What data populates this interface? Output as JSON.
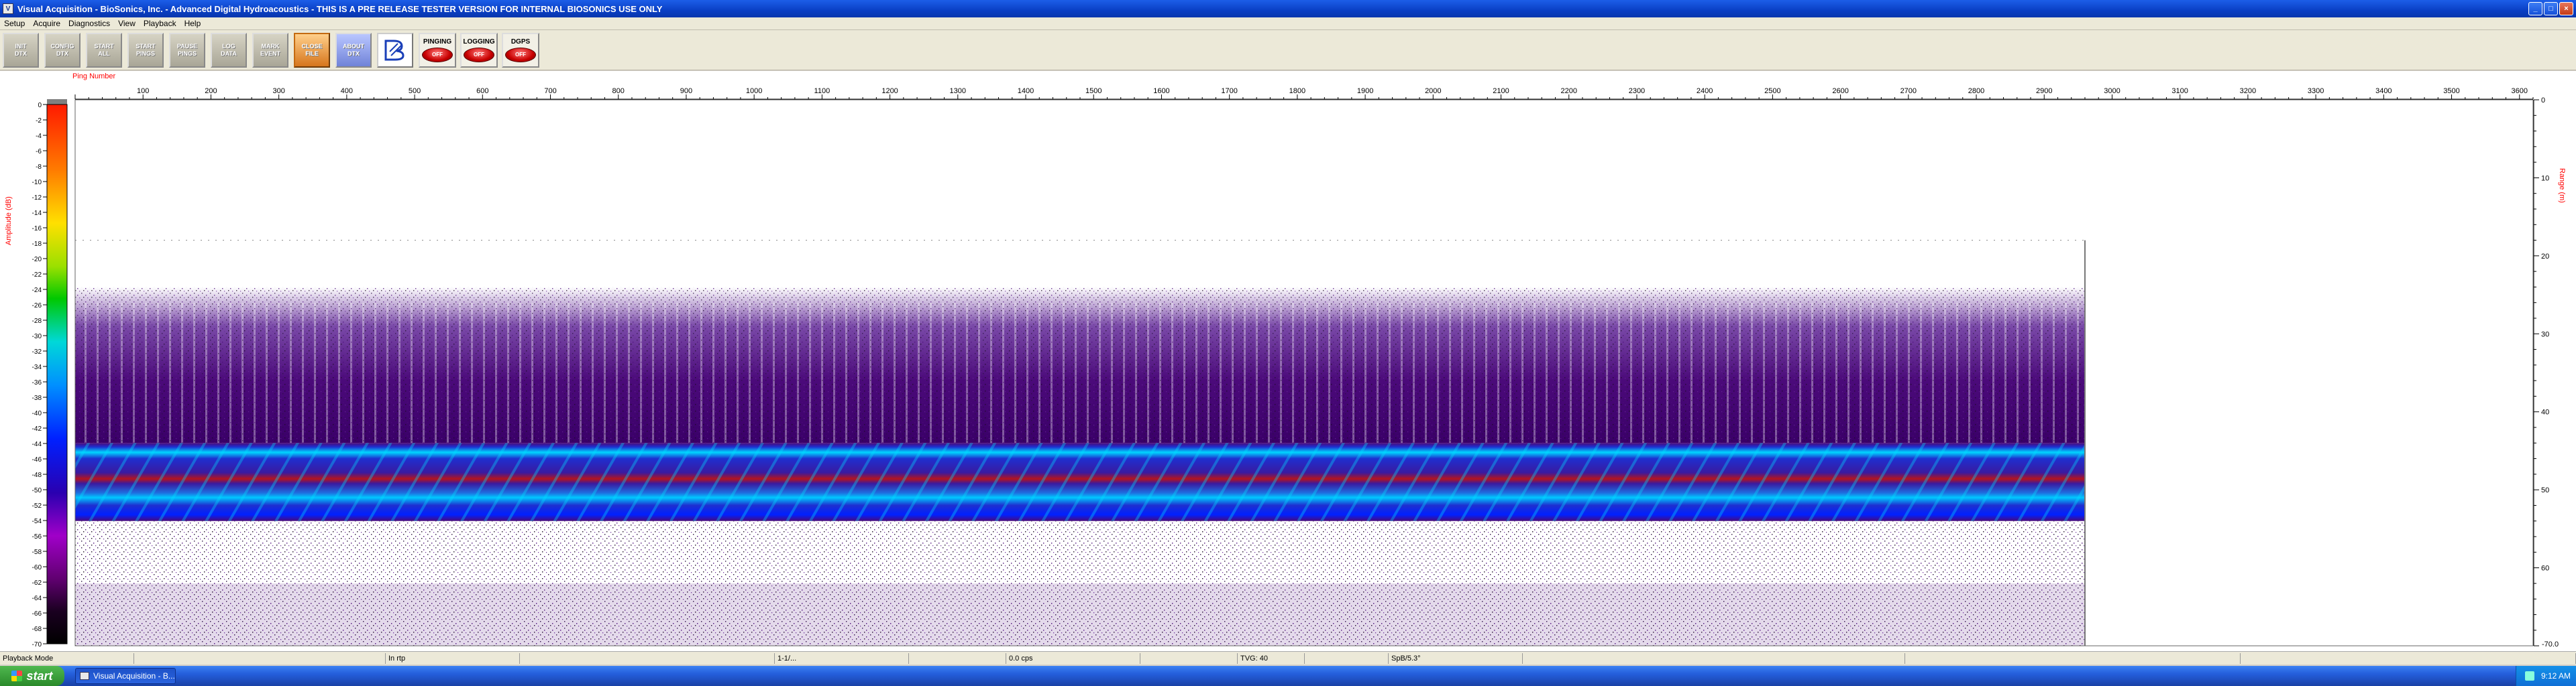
{
  "window": {
    "title": "Visual Acquisition  -  BioSonics, Inc.  -  Advanced Digital Hydroacoustics  -  THIS IS A PRE RELEASE TESTER VERSION FOR INTERNAL BIOSONICS USE ONLY",
    "minimize_label": "_",
    "maximize_label": "□",
    "close_label": "×"
  },
  "menu": [
    "Setup",
    "Acquire",
    "Diagnostics",
    "View",
    "Playback",
    "Help"
  ],
  "toolbar": {
    "buttons": [
      {
        "label": "INIT\nDTX"
      },
      {
        "label": "CONFIG\nDTX"
      },
      {
        "label": "START\nALL"
      },
      {
        "label": "START\nPINGS"
      },
      {
        "label": "PAUSE\nPINGS"
      },
      {
        "label": "LOG\nDATA"
      },
      {
        "label": "MARK\nEVENT"
      },
      {
        "label": "CLOSE\nFILE"
      },
      {
        "label": "ABOUT\nDTX"
      }
    ],
    "indicators": [
      {
        "label": "PINGING",
        "state": "OFF"
      },
      {
        "label": "LOGGING",
        "state": "OFF"
      },
      {
        "label": "DGPS",
        "state": "OFF"
      }
    ]
  },
  "echogram": {
    "x_axis_title": "Ping Number",
    "x_ticks": [
      100,
      200,
      300,
      400,
      500,
      600,
      700,
      800,
      900,
      1000,
      1100,
      1200,
      1300,
      1400,
      1500,
      1600,
      1700,
      1800,
      1900,
      2000,
      2100,
      2200,
      2300,
      2400,
      2500,
      2600,
      2700,
      2800,
      2900,
      3000,
      3100,
      3200,
      3300,
      3400,
      3500,
      3600
    ],
    "x_range": [
      0,
      3620
    ],
    "data_last_ping": 2960,
    "colorbar_title": "Amplitude (dB)",
    "colorbar_ticks": [
      0,
      -2,
      -4,
      -6,
      -8,
      -10,
      -12,
      -14,
      -16,
      -18,
      -20,
      -22,
      -24,
      -26,
      -28,
      -30,
      -32,
      -34,
      -36,
      -38,
      -40,
      -42,
      -44,
      -46,
      -48,
      -50,
      -52,
      -54,
      -56,
      -58,
      -60,
      -62,
      -64,
      -66,
      -68,
      -70
    ],
    "depth_title": "Range (m)",
    "depth_ticks": [
      0,
      10,
      20,
      30,
      40,
      50,
      60
    ],
    "depth_end_label": "-70.0",
    "depth_range": [
      0,
      70
    ],
    "bottom_band_depth": [
      44,
      54
    ],
    "colors": {
      "noise": "#4b0a7a",
      "band_edge": "#00d5ff",
      "band_core": "#1e2fd0",
      "band_red": "#b4141e"
    }
  },
  "status": [
    "Playback Mode",
    "",
    "In rtp",
    "",
    "1-1/...",
    "",
    "0.0 cps",
    "",
    "TVG: 40",
    "",
    "SpB/5.3°",
    "",
    "",
    ""
  ],
  "taskbar": {
    "start_label": "start",
    "task_label": "Visual Acquisition - B...",
    "clock": "9:12 AM"
  }
}
